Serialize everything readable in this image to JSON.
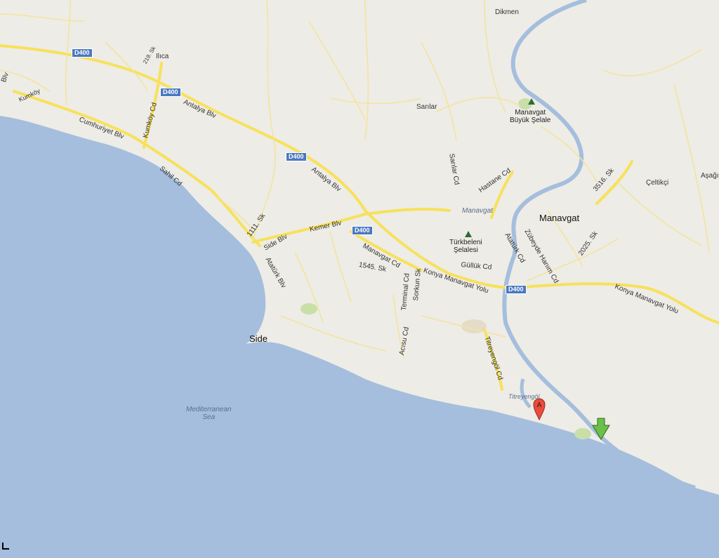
{
  "places": {
    "manavgat": "Manavgat",
    "side": "Side",
    "ilica": "Ilıca",
    "dikmen": "Dikmen",
    "sarilar": "Sarılar",
    "celtikci": "Çeltikçi",
    "asagi": "Aşağı",
    "titreyengol": "Titreyengöl"
  },
  "pois": {
    "waterfall": [
      "Manavgat",
      "Büyük Şelale"
    ],
    "turkbeleni": [
      "Türkbeleni",
      "Şelalesi"
    ]
  },
  "water": {
    "sea": [
      "Mediterranean",
      "Sea"
    ],
    "river": "Manavgat"
  },
  "roads": {
    "d400": "D400",
    "antalya_blv": "Antalya Blv",
    "cumhuriyet_blv": "Cumhuriyet Blv",
    "kumkoy_cd": "Kumköy Cd",
    "sahil_cd": "Sahil Cd",
    "side_blv": "Side Blv",
    "ataturk_blv": "Atatürk Blv",
    "kemer_blv": "Kemer Blv",
    "manavgat_cd": "Manavgat Cd",
    "s1545": "1545. Sk",
    "s1111": "1111. Sk",
    "terminal_cd": "Terminal Cd",
    "sorkun_sk": "Sorkun Sk",
    "acisu_cd": "Acısu Cd",
    "konya_manavgat_yolu": "Konya Manavgat Yolu",
    "gulluk_cd": "Güllük Cd",
    "ataturk_cd": "Atatürk Cd",
    "zubeyde_hanim_cd": "Zübeyde Hanım Cd",
    "s2025": "2025. Sk",
    "s3516": "3516. Sk",
    "hastane_cd": "Hastane Cd",
    "sarilar_cd": "Sarılar Cd",
    "titreyengol_cd": "Titreyengöl Cd",
    "s219": "219. Sk",
    "blv_left": "Blv",
    "kumkoy_left": "Kumköy"
  },
  "markers": {
    "a_label": "A",
    "a_color": "#e74c3c",
    "b_color": "#6cc04a"
  },
  "colors": {
    "land": "#eeece6",
    "sea": "#a5bedd",
    "road": "#f7e15a",
    "river": "#a5bedd",
    "park": "#c8dfa8"
  }
}
